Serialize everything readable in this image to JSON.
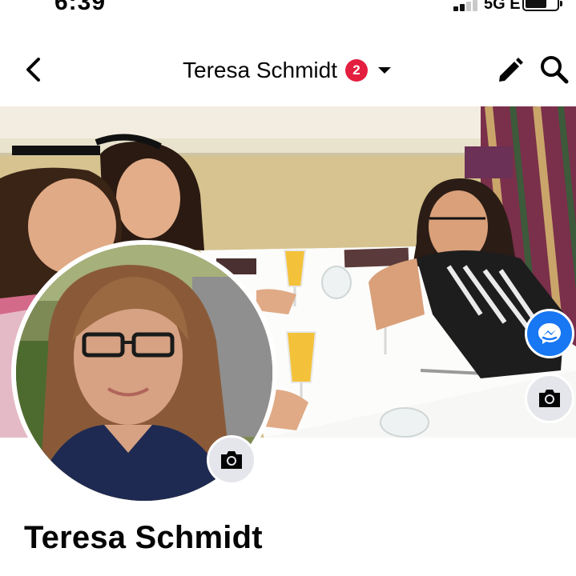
{
  "status_bar": {
    "time": "6:39",
    "network": "5G E",
    "signal_bars_active": 2,
    "signal_bars_total": 4
  },
  "header": {
    "title": "Teresa Schmidt",
    "notification_count": "2",
    "icons": {
      "back": "chevron-left-icon",
      "dropdown": "caret-down-icon",
      "edit": "pencil-icon",
      "search": "search-icon"
    }
  },
  "cover": {
    "messenger_icon": "messenger-icon",
    "camera_icon": "camera-icon"
  },
  "profile": {
    "name": "Teresa Schmidt",
    "camera_icon": "camera-icon"
  },
  "colors": {
    "badge": "#e41e3f",
    "messenger_blue": "#1877f2",
    "icon_button_bg": "#e4e6eb",
    "text": "#050505"
  }
}
